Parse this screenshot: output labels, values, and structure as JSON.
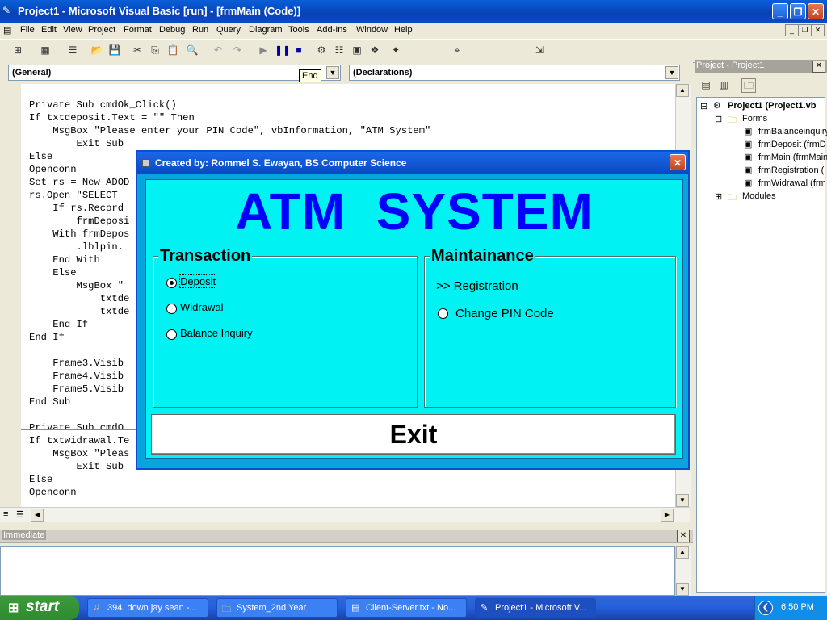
{
  "window": {
    "title": "Project1 - Microsoft Visual Basic [run] - [frmMain (Code)]",
    "minimize": "_",
    "restore": "❐",
    "close": "✕"
  },
  "menu": [
    "File",
    "Edit",
    "View",
    "Project",
    "Format",
    "Debug",
    "Run",
    "Query",
    "Diagram",
    "Tools",
    "Add-Ins",
    "Window",
    "Help"
  ],
  "code_window": {
    "object_combo": "(General)",
    "procedure_combo": "(Declarations)",
    "tooltip": "End",
    "lines": [
      "Private Sub cmdOk_Click()",
      "If txtdeposit.Text = \"\" Then",
      "    MsgBox \"Please enter your PIN Code\", vbInformation, \"ATM System\"",
      "        Exit Sub",
      "Else",
      "Openconn",
      "Set rs = New ADOD",
      "rs.Open \"SELECT",
      "    If rs.Record",
      "        frmDeposi",
      "    With frmDepos",
      "        .lblpin.",
      "    End With",
      "    Else",
      "        MsgBox \"",
      "            txtde",
      "            txtde",
      "    End If",
      "End If",
      "",
      "    Frame3.Visib",
      "    Frame4.Visib",
      "    Frame5.Visib",
      "End Sub",
      "",
      "Private Sub cmdO",
      "If txtwidrawal.Te",
      "    MsgBox \"Pleas",
      "        Exit Sub",
      "Else",
      "Openconn"
    ]
  },
  "immediate": {
    "title": "Immediate"
  },
  "project": {
    "title": "Project - Project1",
    "root": "Project1 (Project1.vb",
    "forms_folder": "Forms",
    "forms": [
      "frmBalanceinquiry",
      "frmDeposit (frmD",
      "frmMain (frmMain",
      "frmRegistration (",
      "frmWidrawal (frm"
    ],
    "modules_folder": "Modules"
  },
  "dialog": {
    "title": "Created by: Rommel  S.  Ewayan, BS Computer Science",
    "heading": "ATM  SYSTEM",
    "heading_color": "#0000ff",
    "transaction": {
      "legend": "Transaction",
      "options": [
        {
          "label": "Deposit",
          "selected": true
        },
        {
          "label": "Widrawal",
          "selected": false
        },
        {
          "label": "Balance Inquiry",
          "selected": false
        }
      ]
    },
    "maintainance": {
      "legend": "Maintainance",
      "registration": ">> Registration",
      "change_pin": "Change PIN Code"
    },
    "exit_label": "Exit"
  },
  "taskbar": {
    "start": "start",
    "tasks": [
      {
        "label": "394. down jay sean -...",
        "icon": "media-player-icon"
      },
      {
        "label": "System_2nd Year",
        "icon": "folder-icon"
      },
      {
        "label": "Client-Server.txt - No...",
        "icon": "notepad-icon"
      },
      {
        "label": "Project1 - Microsoft V...",
        "icon": "vb-icon"
      }
    ],
    "clock": "6:50 PM"
  }
}
